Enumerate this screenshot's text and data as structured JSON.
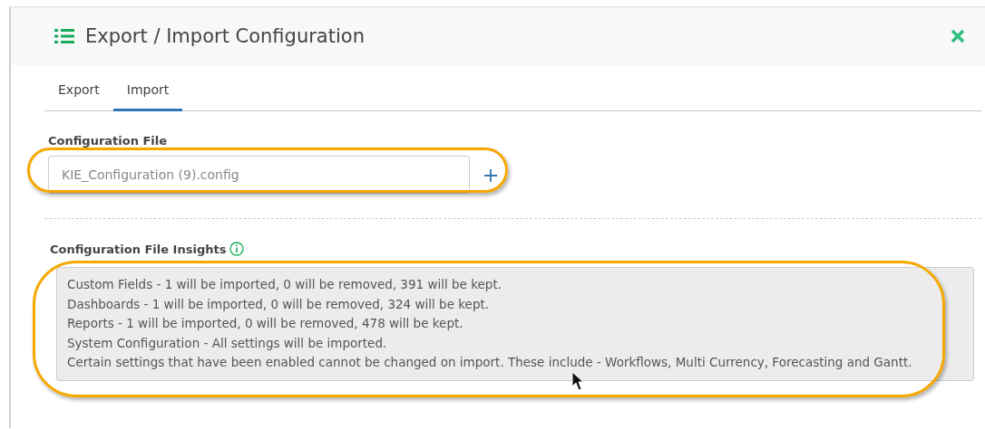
{
  "dialog": {
    "title": "Export / Import Configuration"
  },
  "tabs": [
    {
      "label": "Export",
      "selected": false
    },
    {
      "label": "Import",
      "selected": true
    }
  ],
  "file_field": {
    "label": "Configuration File",
    "value": "KIE_Configuration (9).config"
  },
  "insights": {
    "label": "Configuration File Insights",
    "lines": [
      "Custom Fields - 1 will be imported, 0 will be removed, 391 will be kept.",
      "Dashboards - 1 will be imported, 0 will be removed, 324 will be kept.",
      "Reports - 1 will be imported, 0 will be removed, 478 will be kept.",
      "System Configuration - All settings will be imported.",
      "Certain settings that have been enabled cannot be changed on import. These include - Workflows, Multi Currency, Forecasting and Gantt."
    ]
  }
}
